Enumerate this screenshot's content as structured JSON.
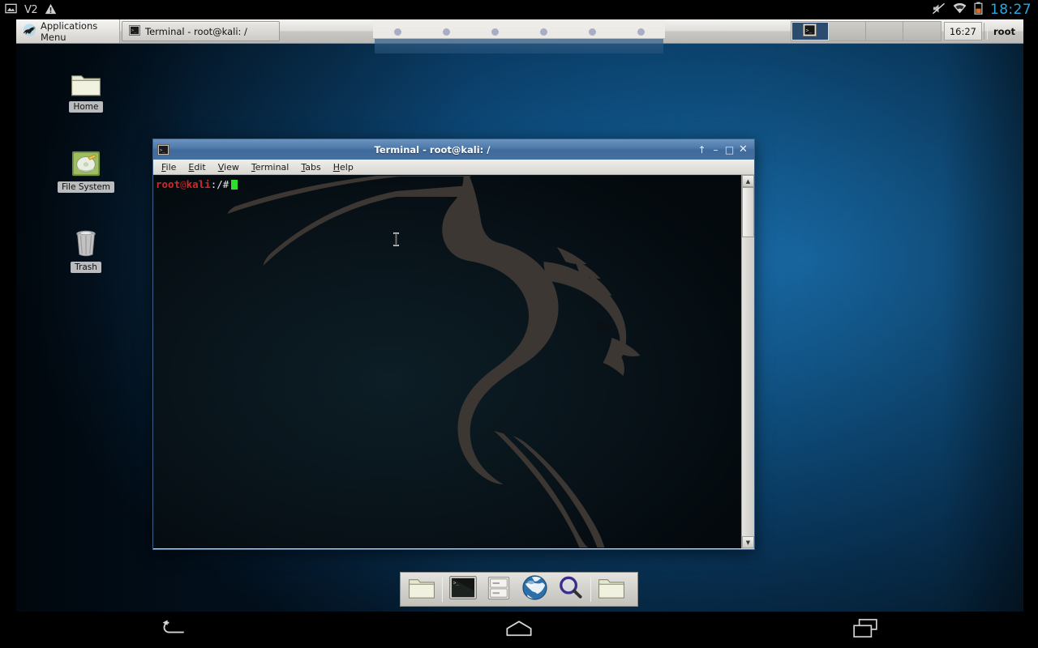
{
  "android_status_bar": {
    "icons": [
      "screenshot-icon",
      "vpn-icon",
      "warning-icon"
    ],
    "vpn_label": "V2",
    "right_icons": [
      "mute-icon",
      "wifi-icon",
      "battery-icon"
    ],
    "clock": "18:27"
  },
  "xfce_panel": {
    "applications_menu": "Applications Menu",
    "task_button": "Terminal - root@kali: /",
    "workspaces": [
      "1",
      "2",
      "3",
      "4"
    ],
    "active_workspace": 1,
    "clock": "16:27",
    "user": "root"
  },
  "desktop": {
    "icons": [
      {
        "label": "Home",
        "icon": "folder-icon"
      },
      {
        "label": "File System",
        "icon": "harddisk-icon"
      },
      {
        "label": "Trash",
        "icon": "trash-icon"
      }
    ]
  },
  "terminal_window": {
    "title": "Terminal - root@kali: /",
    "titlebar_icon": "terminal-icon",
    "controls": {
      "shade": "↑",
      "minimize": "–",
      "maximize": "□",
      "close": "✕"
    },
    "menus": [
      {
        "label": "File",
        "accel": "F"
      },
      {
        "label": "Edit",
        "accel": "E"
      },
      {
        "label": "View",
        "accel": "V"
      },
      {
        "label": "Terminal",
        "accel": "T"
      },
      {
        "label": "Tabs",
        "accel": "b"
      },
      {
        "label": "Help",
        "accel": "l"
      }
    ],
    "prompt": {
      "user": "root",
      "at": "@",
      "host": "kali",
      "path": ":/#",
      "cursor": "block"
    },
    "wallpaper": "kali-dragon"
  },
  "dock": {
    "items": [
      {
        "name": "file-manager-icon",
        "label": "File Manager"
      },
      {
        "name": "terminal-icon",
        "label": "Terminal"
      },
      {
        "name": "archive-manager-icon",
        "label": "Archive Manager"
      },
      {
        "name": "web-browser-icon",
        "label": "Web Browser"
      },
      {
        "name": "search-icon",
        "label": "Find Files"
      },
      {
        "name": "folder-icon",
        "label": "Folder"
      }
    ]
  },
  "touch_overlay": {
    "dots": 6
  },
  "android_nav_bar": {
    "buttons": [
      {
        "name": "back-button",
        "icon": "back-icon"
      },
      {
        "name": "home-button",
        "icon": "home-icon"
      },
      {
        "name": "recents-button",
        "icon": "recents-icon"
      }
    ]
  },
  "colors": {
    "desktop_blue": "#1c79bf",
    "titlebar_blue": "#4e7aab",
    "prompt_red": "#cf2a2a",
    "cursor_green": "#2ee02e",
    "status_clock_blue": "#2aa7e0"
  }
}
